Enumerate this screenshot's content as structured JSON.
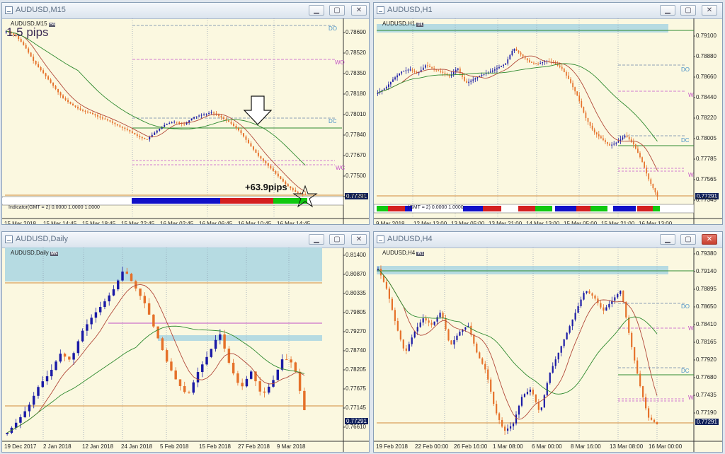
{
  "colors": {
    "bull": "#1a1aa6",
    "bear": "#e5712a",
    "bg": "#fbf8e0",
    "sma_fast": "#b24a3a",
    "sma_slow": "#2f8a2f",
    "zone": "#a9d6e2"
  },
  "windows": [
    {
      "key": "m15",
      "title": "AUDUSD,M15",
      "symbol_label": "AUDUSD,M15",
      "tf_badge": "H4",
      "yticks": [
        "0.78690",
        "0.78520",
        "0.78350",
        "0.78180",
        "0.78010",
        "0.77840",
        "0.77670",
        "0.77500",
        "0.77330"
      ],
      "xticks": [
        "15 Mar 2018",
        "15 Mar 14:45",
        "15 Mar 18:45",
        "15 Mar 22:45",
        "16 Mar 02:45",
        "16 Mar 06:45",
        "16 Mar 10:45",
        "16 Mar 14:45"
      ],
      "levels": [
        "DO",
        "WO",
        "DC",
        "WC"
      ],
      "price": "0.77291",
      "pips": "1.5 pips",
      "gain": "+63.9pips",
      "indicator_text": "Indicator(GMT = 2) 0.0000 1.0000 1.0000"
    },
    {
      "key": "h1",
      "title": "AUDUSD,H1",
      "symbol_label": "AUDUSD,H1",
      "tf_badge": "D1",
      "yticks": [
        "0.79100",
        "0.78880",
        "0.78660",
        "0.78440",
        "0.78220",
        "0.78005",
        "0.77785",
        "0.77565",
        "0.77345"
      ],
      "xticks": [
        "9 Mar 2018",
        "12 Mar 13:00",
        "13 Mar 05:00",
        "13 Mar 21:00",
        "14 Mar 13:00",
        "15 Mar 05:00",
        "15 Mar 21:00",
        "16 Mar 13:00"
      ],
      "levels": [
        "DO",
        "W",
        "DC",
        "W"
      ],
      "price": "0.77291",
      "indicator_text": "(GMT = 2) 0.0000 1.0000"
    },
    {
      "key": "daily",
      "title": "AUDUSD,Daily",
      "symbol_label": "AUDUSD,Daily",
      "tf_badge": "MN",
      "yticks": [
        "0.81400",
        "0.80870",
        "0.80335",
        "0.79805",
        "0.79270",
        "0.78740",
        "0.78205",
        "0.77675",
        "0.77145",
        "0.76610"
      ],
      "xticks": [
        "19 Dec 2017",
        "2 Jan 2018",
        "12 Jan 2018",
        "24 Jan 2018",
        "5 Feb 2018",
        "15 Feb 2018",
        "27 Feb 2018",
        "9 Mar 2018"
      ],
      "price": "0.77291"
    },
    {
      "key": "h4",
      "title": "AUDUSD,H4",
      "symbol_label": "AUDUSD,H4",
      "tf_badge": "W1",
      "yticks": [
        "0.79380",
        "0.79140",
        "0.78895",
        "0.78650",
        "0.78410",
        "0.78165",
        "0.77920",
        "0.77680",
        "0.77435",
        "0.77190"
      ],
      "xticks": [
        "19 Feb 2018",
        "22 Feb 00:00",
        "26 Feb 16:00",
        "1 Mar 08:00",
        "6 Mar 00:00",
        "8 Mar 16:00",
        "13 Mar 08:00",
        "16 Mar 00:00"
      ],
      "levels": [
        "DO",
        "W",
        "DC",
        "W"
      ],
      "price": "0.77291"
    }
  ]
}
